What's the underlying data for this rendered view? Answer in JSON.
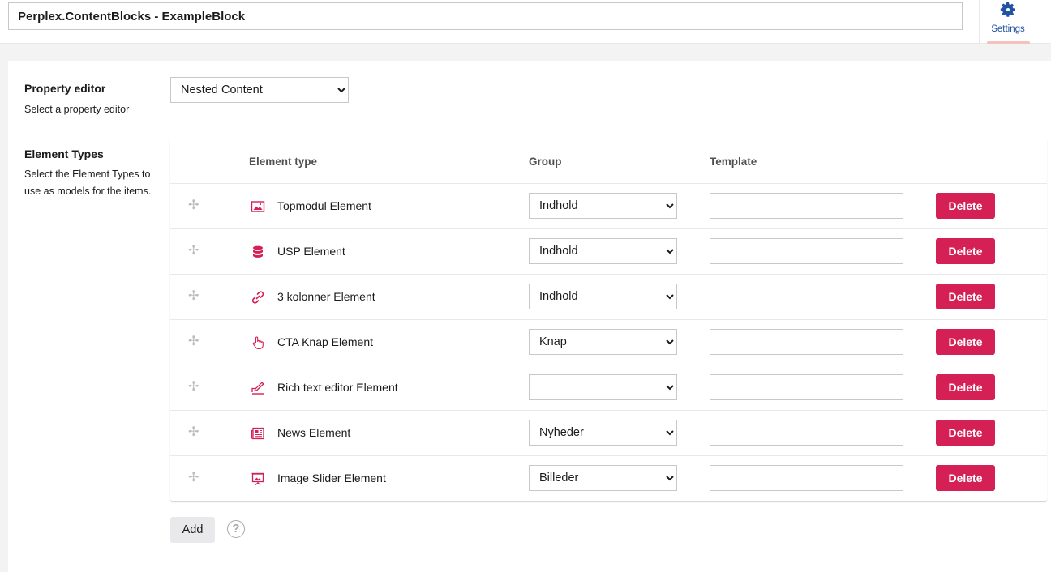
{
  "header": {
    "name_value": "Perplex.ContentBlocks - ExampleBlock",
    "settings_label": "Settings"
  },
  "property_editor": {
    "label": "Property editor",
    "description": "Select a property editor",
    "selected": "Nested Content"
  },
  "element_types": {
    "label": "Element Types",
    "description_lines": [
      "Select the Element Types to",
      "use as models for the items."
    ],
    "columns": {
      "element_type": "Element type",
      "group": "Group",
      "template": "Template"
    },
    "delete_label": "Delete",
    "rows": [
      {
        "name": "Topmodul Element",
        "icon": "picture-icon",
        "group": "Indhold",
        "template": ""
      },
      {
        "name": "USP Element",
        "icon": "database-icon",
        "group": "Indhold",
        "template": ""
      },
      {
        "name": "3 kolonner Element",
        "icon": "link-icon",
        "group": "Indhold",
        "template": ""
      },
      {
        "name": "CTA Knap Element",
        "icon": "hand-pointer-icon",
        "group": "Knap",
        "template": ""
      },
      {
        "name": "Rich text editor Element",
        "icon": "edit-icon",
        "group": "",
        "template": ""
      },
      {
        "name": "News Element",
        "icon": "newspaper-icon",
        "group": "Nyheder",
        "template": ""
      },
      {
        "name": "Image Slider Element",
        "icon": "presentation-icon",
        "group": "Billeder",
        "template": ""
      }
    ]
  },
  "add_label": "Add",
  "help_glyph": "?",
  "drag_glyph": "✢",
  "colors": {
    "accent": "#d42054",
    "settings_blue": "#2152a3",
    "settings_underline": "#f5c1bc"
  }
}
